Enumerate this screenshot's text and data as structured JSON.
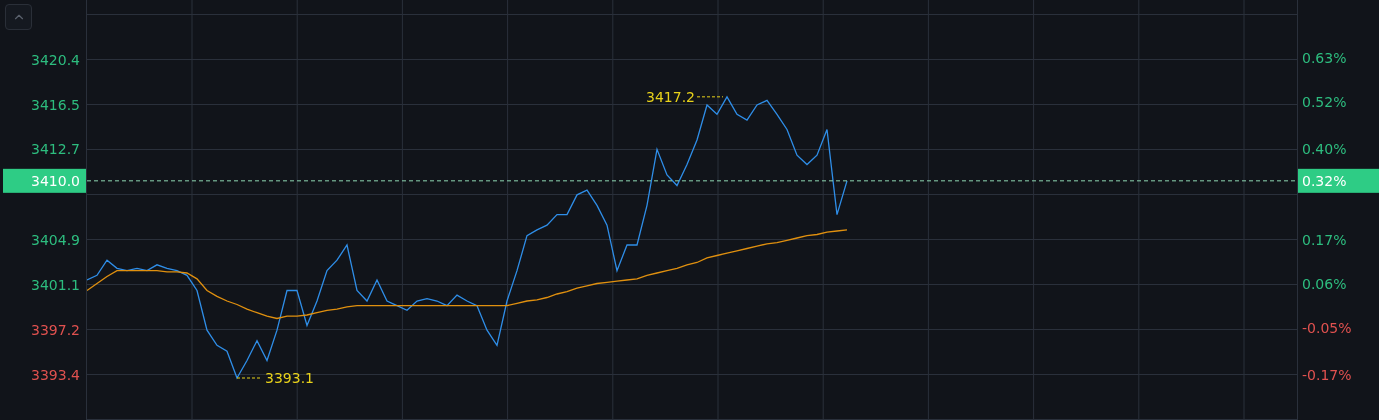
{
  "chart_data": {
    "type": "line",
    "grid": true,
    "ylim": [
      3389.5,
      3425.5
    ],
    "ref_lines": [
      {
        "axis": "y",
        "value": 3410.0,
        "label": "3410.0"
      }
    ],
    "yticks": [
      {
        "value": 3420.4,
        "label": "3420.4"
      },
      {
        "value": 3416.5,
        "label": "3416.5"
      },
      {
        "value": 3412.7,
        "label": "3412.7"
      },
      {
        "value": 3404.9,
        "label": "3404.9"
      },
      {
        "value": 3401.1,
        "label": "3401.1"
      },
      {
        "value": 3397.2,
        "label": "3397.2"
      },
      {
        "value": 3393.4,
        "label": "3393.4"
      }
    ],
    "series": [
      {
        "color": "#2f8ee8",
        "values": [
          3401.5,
          3401.9,
          3403.2,
          3402.5,
          3402.3,
          3402.5,
          3402.3,
          3402.8,
          3402.5,
          3402.3,
          3401.9,
          3400.6,
          3397.2,
          3395.9,
          3395.4,
          3393.1,
          3394.6,
          3396.3,
          3394.6,
          3397.2,
          3400.6,
          3400.6,
          3397.6,
          3399.7,
          3402.3,
          3403.2,
          3404.5,
          3400.6,
          3399.7,
          3401.5,
          3399.7,
          3399.3,
          3398.9,
          3399.7,
          3399.9,
          3399.7,
          3399.3,
          3400.2,
          3399.7,
          3399.3,
          3397.2,
          3395.9,
          3399.7,
          3402.3,
          3405.3,
          3405.8,
          3406.2,
          3407.1,
          3407.1,
          3408.8,
          3409.2,
          3407.9,
          3406.2,
          3402.3,
          3404.5,
          3404.5,
          3407.9,
          3412.7,
          3410.5,
          3409.6,
          3411.4,
          3413.5,
          3416.5,
          3415.7,
          3417.2,
          3415.7,
          3415.2,
          3416.5,
          3416.9,
          3415.7,
          3414.4,
          3412.2,
          3411.4,
          3412.2,
          3414.4,
          3407.1,
          3410.0
        ]
      },
      {
        "color": "#e0900f",
        "values": [
          3400.6,
          3401.2,
          3401.8,
          3402.3,
          3402.3,
          3402.3,
          3402.3,
          3402.3,
          3402.2,
          3402.2,
          3402.1,
          3401.6,
          3400.6,
          3400.1,
          3399.7,
          3399.4,
          3399.0,
          3398.7,
          3398.4,
          3398.2,
          3398.4,
          3398.4,
          3398.5,
          3398.7,
          3398.9,
          3399.0,
          3399.2,
          3399.3,
          3399.3,
          3399.3,
          3399.3,
          3399.3,
          3399.3,
          3399.3,
          3399.3,
          3399.3,
          3399.3,
          3399.3,
          3399.3,
          3399.3,
          3399.3,
          3399.3,
          3399.3,
          3399.5,
          3399.7,
          3399.8,
          3400.0,
          3400.3,
          3400.5,
          3400.8,
          3401.0,
          3401.2,
          3401.3,
          3401.4,
          3401.5,
          3401.6,
          3401.9,
          3402.1,
          3402.3,
          3402.5,
          3402.8,
          3403.0,
          3403.4,
          3403.6,
          3403.8,
          3404.0,
          3404.2,
          3404.4,
          3404.6,
          3404.7,
          3404.9,
          3405.1,
          3405.3,
          3405.4,
          3405.6,
          3405.7,
          3405.8
        ]
      }
    ],
    "annotations": [
      {
        "text": "3417.2"
      },
      {
        "text": "3393.1"
      }
    ]
  },
  "right_axis": [
    {
      "label": "0.63%",
      "color": "#2dbd7f"
    },
    {
      "label": "0.52%",
      "color": "#2dbd7f"
    },
    {
      "label": "0.40%",
      "color": "#2dbd7f"
    },
    {
      "label": "0.17%",
      "color": "#2dbd7f"
    },
    {
      "label": "0.06%",
      "color": "#2dbd7f"
    },
    {
      "label": "-0.05%",
      "color": "#e0514f"
    },
    {
      "label": "-0.17%",
      "color": "#e0514f"
    }
  ],
  "current": {
    "change": "0.32%",
    "color": "#2ecc85"
  }
}
